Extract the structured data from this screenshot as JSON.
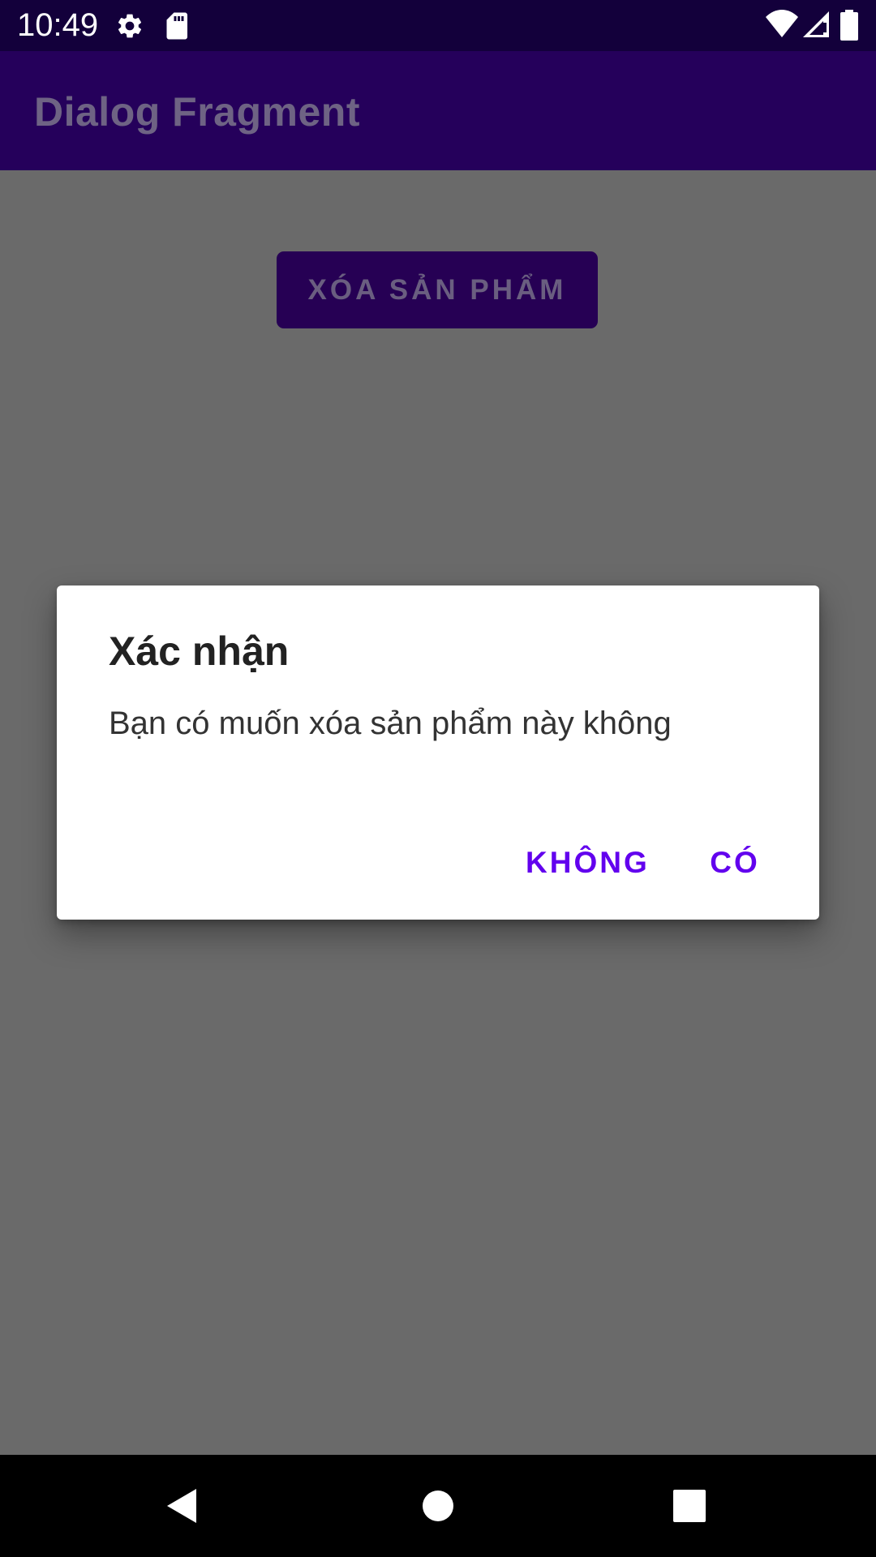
{
  "status_bar": {
    "time": "10:49",
    "icons": [
      "settings-icon",
      "sd-card-icon",
      "wifi-icon",
      "signal-icon",
      "battery-icon"
    ]
  },
  "app_bar": {
    "title": "Dialog Fragment"
  },
  "main": {
    "delete_button_label": "XÓA SẢN PHẨM"
  },
  "dialog": {
    "title": "Xác nhận",
    "message": "Bạn có muốn xóa sản phẩm này không",
    "negative_label": "KHÔNG",
    "positive_label": "CÓ"
  },
  "nav_bar": {
    "icons": [
      "back-icon",
      "home-icon",
      "recents-icon"
    ]
  },
  "colors": {
    "status_bar": "#13003b",
    "app_bar": "#25005b",
    "scrim_background": "#6a6a6a",
    "dialog_accent": "#6200ee",
    "dialog_background": "#ffffff"
  }
}
